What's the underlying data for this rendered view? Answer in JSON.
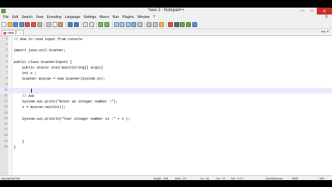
{
  "window": {
    "title": "*new 2 - Notepad++",
    "controls": {
      "minimize": "—",
      "maximize": "□",
      "close": "✕"
    }
  },
  "menu": {
    "items": [
      "File",
      "Edit",
      "Search",
      "View",
      "Encoding",
      "Language",
      "Settings",
      "Macro",
      "Run",
      "Plugins",
      "Window",
      "?"
    ],
    "close_glyph": "X"
  },
  "toolbar": {
    "buttons": [
      {
        "name": "new-file-icon",
        "color": "#ffffff",
        "border": "#9a9a9a"
      },
      {
        "name": "open-file-icon",
        "color": "#e8b84a",
        "border": "#b8862a"
      },
      {
        "name": "save-icon",
        "color": "#5b8fd4",
        "border": "#2f5f9e"
      },
      {
        "name": "save-all-icon",
        "color": "#5b8fd4",
        "border": "#2f5f9e"
      },
      {
        "name": "close-file-icon",
        "color": "#d9534f",
        "border": "#a02f2b"
      },
      {
        "name": "close-all-icon",
        "color": "#d9534f",
        "border": "#a02f2b"
      },
      {
        "name": "print-icon",
        "color": "#b5b5b5",
        "border": "#777777"
      },
      {
        "sep": true
      },
      {
        "name": "cut-icon",
        "color": "#c7c7c7",
        "border": "#8a8a8a"
      },
      {
        "name": "copy-icon",
        "color": "#ffffff",
        "border": "#8a8a8a"
      },
      {
        "name": "paste-icon",
        "color": "#c9a46a",
        "border": "#8a6a3a"
      },
      {
        "sep": true
      },
      {
        "name": "undo-icon",
        "color": "#4a7ec4",
        "border": "#2f5f9e"
      },
      {
        "name": "redo-icon",
        "color": "#4a7ec4",
        "border": "#2f5f9e"
      },
      {
        "sep": true
      },
      {
        "name": "find-icon",
        "color": "#e0e0e0",
        "border": "#8a8a8a"
      },
      {
        "name": "replace-icon",
        "color": "#e0e0e0",
        "border": "#8a8a8a"
      },
      {
        "sep": true
      },
      {
        "name": "zoom-in-icon",
        "color": "#7bbf6a",
        "border": "#3f7a33"
      },
      {
        "name": "zoom-out-icon",
        "color": "#7bbf6a",
        "border": "#3f7a33"
      },
      {
        "sep": true
      },
      {
        "name": "sync-vertical-icon",
        "color": "#a8c8e8",
        "border": "#5a7fa8"
      },
      {
        "name": "sync-horizontal-icon",
        "color": "#a8c8e8",
        "border": "#5a7fa8"
      },
      {
        "name": "word-wrap-icon",
        "color": "#a8c8e8",
        "border": "#5a7fa8"
      },
      {
        "name": "show-all-chars-icon",
        "color": "#7fb2e6",
        "border": "#3a6fa8"
      },
      {
        "name": "indent-guide-icon",
        "color": "#c6c6c6",
        "border": "#7a7a7a"
      },
      {
        "sep": true
      },
      {
        "name": "doc-map-icon",
        "color": "#c6c6c6",
        "border": "#7a7a7a"
      },
      {
        "name": "function-list-icon",
        "color": "#c6c6c6",
        "border": "#7a7a7a"
      },
      {
        "name": "folder-workspace-icon",
        "color": "#e8b84a",
        "border": "#b8862a"
      },
      {
        "sep": true
      },
      {
        "name": "record-macro-icon",
        "color": "#d9534f",
        "border": "#a02f2b"
      },
      {
        "name": "stop-macro-icon",
        "color": "#6a6a6a",
        "border": "#3a3a3a"
      },
      {
        "name": "play-macro-icon",
        "color": "#6aa84f",
        "border": "#38761d"
      },
      {
        "name": "run-macro-multiple-icon",
        "color": "#6aa84f",
        "border": "#38761d"
      },
      {
        "name": "save-macro-icon",
        "color": "#5b8fd4",
        "border": "#2f5f9e"
      }
    ]
  },
  "tab": {
    "label": "new 2",
    "close": "x",
    "arrows": "◂ ▸ ✕"
  },
  "editor": {
    "current_line": 10,
    "lines": [
      {
        "n": "1",
        "fold": "",
        "text": "// How to read input from console"
      },
      {
        "n": "2",
        "fold": "",
        "text": ""
      },
      {
        "n": "3",
        "fold": "",
        "text": "import java.util.Scanner;"
      },
      {
        "n": "4",
        "fold": "",
        "text": ""
      },
      {
        "n": "5",
        "fold": "",
        "text": "public class ScannerInput2 {"
      },
      {
        "n": "6",
        "fold": "",
        "text": "    public static void main(String[] args){"
      },
      {
        "n": "7",
        "fold": "",
        "text": "    int x ;"
      },
      {
        "n": "8",
        "fold": "",
        "text": "    Scanner myscan = new Scanner(System.in);"
      },
      {
        "n": "9",
        "fold": "",
        "text": ""
      },
      {
        "n": "10",
        "fold": "",
        "text": "    "
      },
      {
        "n": "11",
        "fold": "",
        "text": "    // Ask"
      },
      {
        "n": "12",
        "fold": "",
        "text": "    System.out.print(\"Enter an integer number :\");"
      },
      {
        "n": "13",
        "fold": "",
        "text": "    x = myscan.nextInt();"
      },
      {
        "n": "14",
        "fold": "",
        "text": ""
      },
      {
        "n": "15",
        "fold": "",
        "text": "    System.out.println(\"Your integer number is :\" + x );"
      },
      {
        "n": "16",
        "fold": "",
        "text": ""
      },
      {
        "n": "17",
        "fold": "",
        "text": ""
      },
      {
        "n": "18",
        "fold": "",
        "text": ""
      },
      {
        "n": "19",
        "fold": "",
        "text": "    }"
      },
      {
        "n": "20",
        "fold": "",
        "text": "}"
      }
    ]
  },
  "status": {
    "file_type": "Normal text file",
    "length": "length : 348",
    "lines": "lines : 13",
    "ln": "Ln : 10",
    "col": "Col : 11",
    "sel": "Sel : 0 | 0",
    "eol": "Dos\\Windows",
    "encoding": "ANSI",
    "mode": "INS"
  }
}
